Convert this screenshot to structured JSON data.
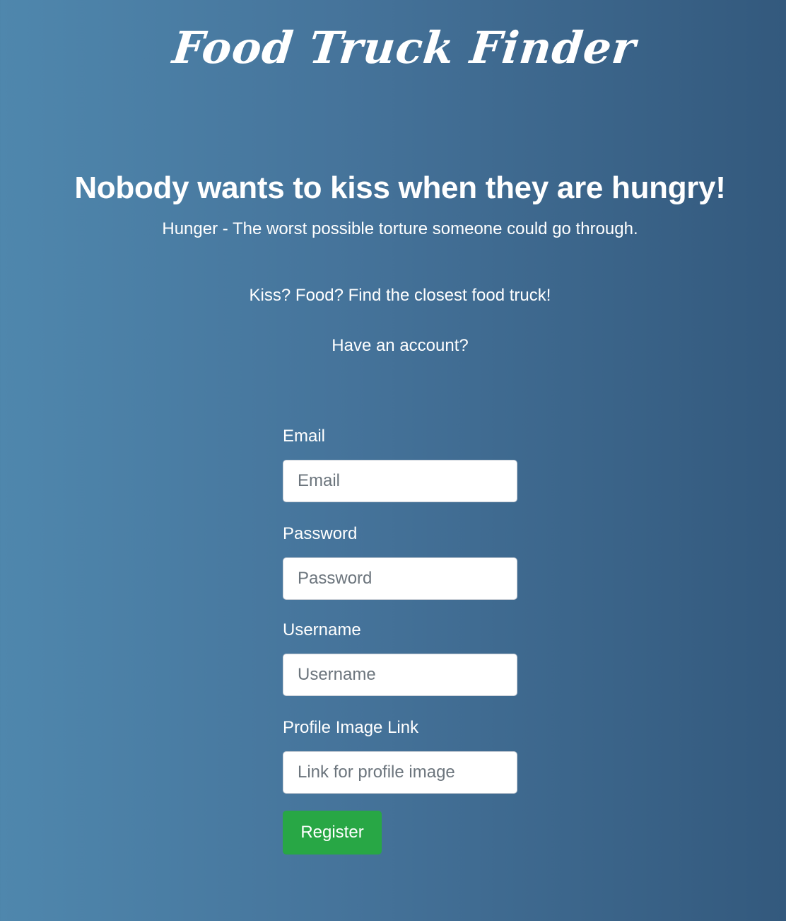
{
  "app": {
    "brand_title": "Food Truck Finder"
  },
  "hero": {
    "heading": "Nobody wants to kiss when they are hungry!",
    "subtitle": "Hunger - The worst possible torture someone could go through."
  },
  "tagline": "Kiss? Food? Find the closest food truck!",
  "account_prompt": "Have an account?",
  "form": {
    "fields": [
      {
        "label": "Email",
        "placeholder": "Email",
        "value": ""
      },
      {
        "label": "Password",
        "placeholder": "Password",
        "value": ""
      },
      {
        "label": "Username",
        "placeholder": "Username",
        "value": ""
      },
      {
        "label": "Profile Image Link",
        "placeholder": "Link for profile image",
        "value": ""
      }
    ],
    "submit_label": "Register"
  },
  "colors": {
    "gradient_start": "#4f87ad",
    "gradient_end": "#33597d",
    "button_green": "#28a745",
    "text": "#ffffff"
  }
}
